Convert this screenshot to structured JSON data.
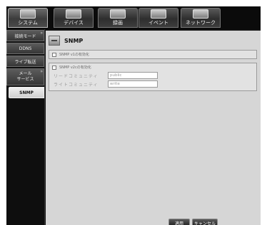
{
  "tabs": [
    {
      "label": "システム",
      "icon": "monitor-icon",
      "active": true
    },
    {
      "label": "デバイス",
      "icon": "camera-icon",
      "active": false
    },
    {
      "label": "録画",
      "icon": "recorder-icon",
      "active": false
    },
    {
      "label": "イベント",
      "icon": "event-icon",
      "active": false
    },
    {
      "label": "ネットワーク",
      "icon": "network-icon",
      "active": false
    }
  ],
  "sidebar": {
    "items": [
      {
        "label": "接続モード",
        "has_arrow": true
      },
      {
        "label": "DDNS"
      },
      {
        "label": "ライブ転送"
      },
      {
        "label": "メール\nサービス",
        "has_arrow": true
      },
      {
        "label": "SNMP",
        "selected": true
      }
    ]
  },
  "panel": {
    "title": "SNMP",
    "v1_enable_label": "SNMP v1の有効化",
    "v2_enable_label": "SNMP v2cの有効化",
    "read_community_label": "リードコミュニティ",
    "read_community_value": "public",
    "write_community_label": "ライトコミュニティ",
    "write_community_value": "write"
  },
  "buttons": {
    "apply": "適用",
    "cancel": "キャンセル"
  }
}
